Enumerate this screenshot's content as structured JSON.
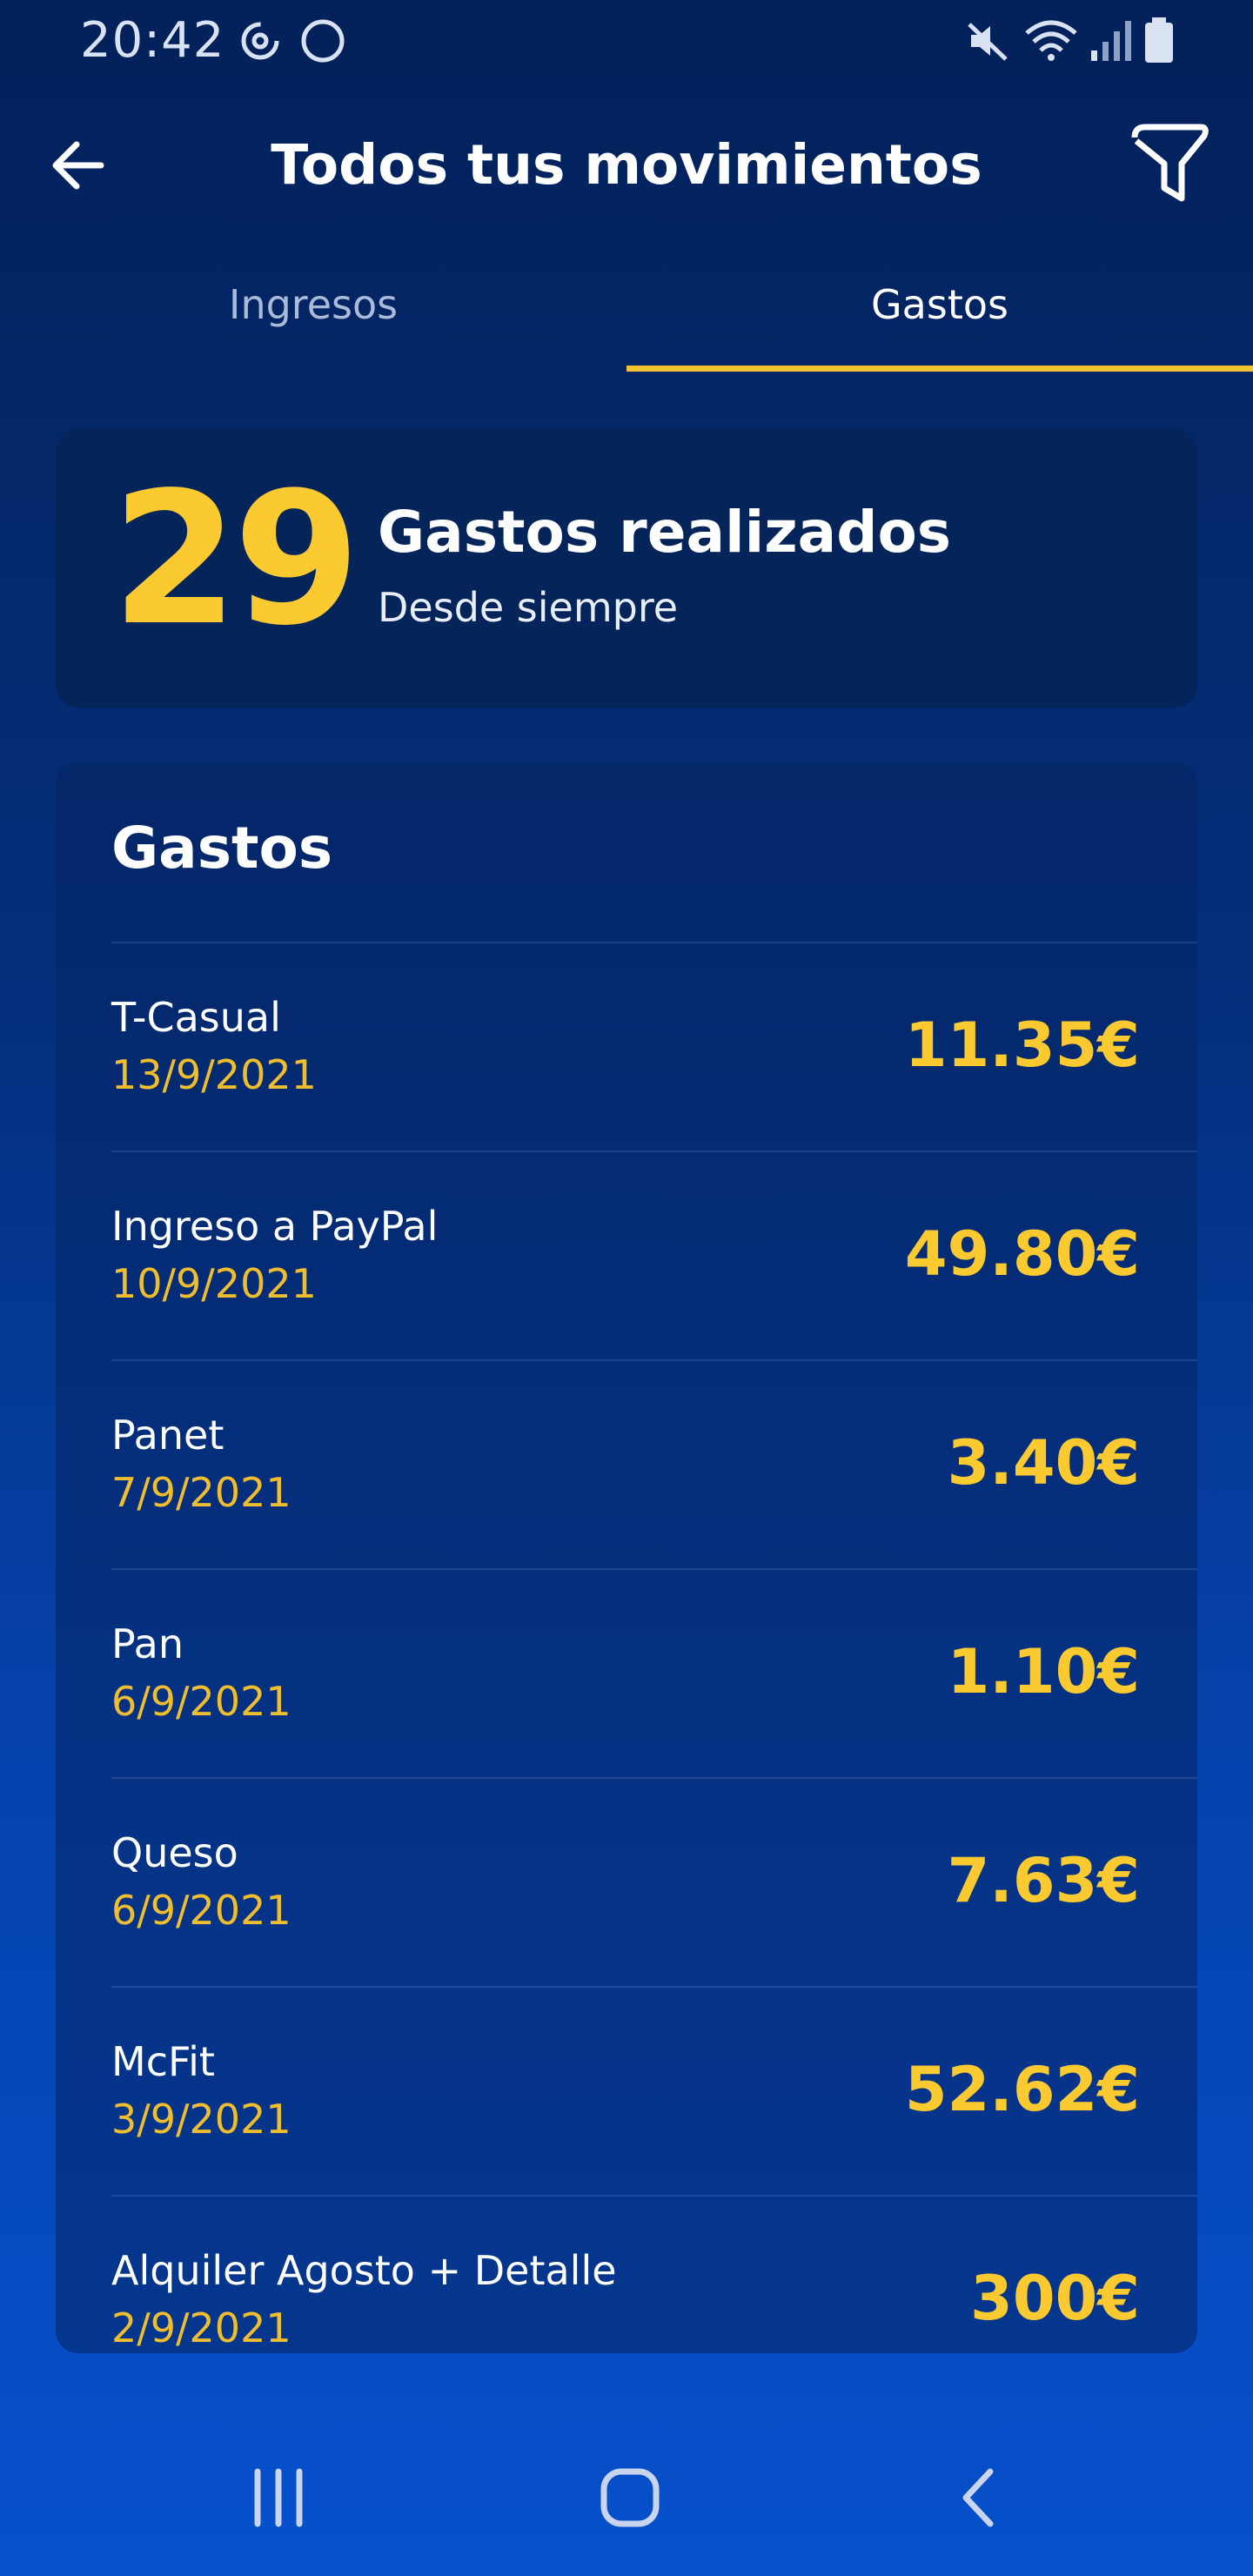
{
  "status_bar": {
    "time": "20:42",
    "icons": [
      "sync-icon",
      "circle-icon",
      "mute-icon",
      "wifi-icon",
      "signal-icon",
      "battery-icon"
    ]
  },
  "header": {
    "title": "Todos tus movimientos",
    "icons": [
      "arrow-left-icon",
      "filter-icon"
    ]
  },
  "tabs": [
    {
      "label": "Ingresos",
      "active": false
    },
    {
      "label": "Gastos",
      "active": true
    }
  ],
  "summary": {
    "count": "29",
    "title": "Gastos realizados",
    "subtitle": "Desde siempre"
  },
  "list": {
    "title": "Gastos",
    "items": [
      {
        "name": "T-Casual",
        "date": "13/9/2021",
        "amount": "11.35€"
      },
      {
        "name": "Ingreso a PayPal",
        "date": "10/9/2021",
        "amount": "49.80€"
      },
      {
        "name": "Panet",
        "date": "7/9/2021",
        "amount": "3.40€"
      },
      {
        "name": "Pan",
        "date": "6/9/2021",
        "amount": "1.10€"
      },
      {
        "name": "Queso",
        "date": "6/9/2021",
        "amount": "7.63€"
      },
      {
        "name": "McFit",
        "date": "3/9/2021",
        "amount": "52.62€"
      },
      {
        "name": "Alquiler Agosto + Detalle",
        "date": "2/9/2021",
        "amount": "300€"
      }
    ]
  },
  "nav_bar": {
    "icons": [
      "recent-apps-icon",
      "home-icon",
      "back-icon"
    ]
  },
  "colors": {
    "accent": "#fbc930",
    "background_top": "#03215a",
    "background_bottom": "#0650cc",
    "card": "#052459"
  }
}
